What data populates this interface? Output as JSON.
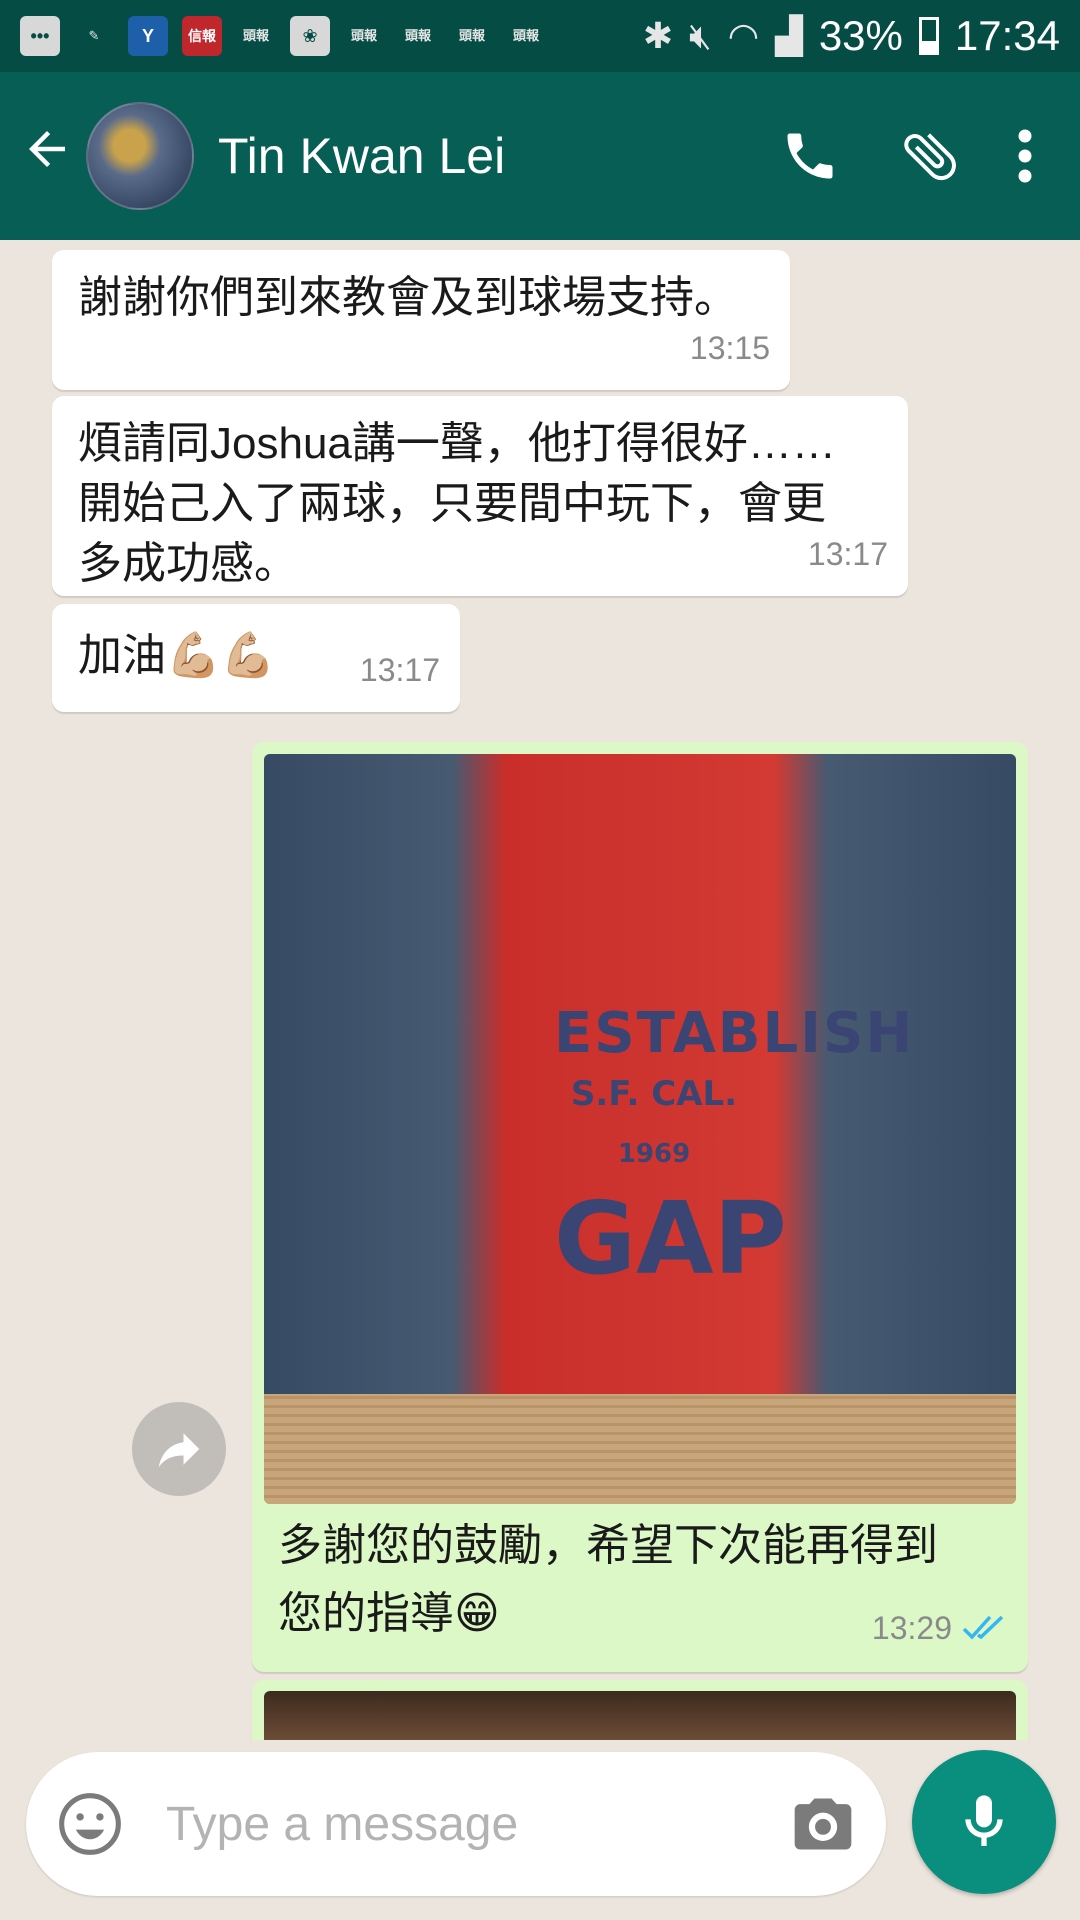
{
  "status_bar": {
    "battery": "33%",
    "time": "17:34",
    "notification_icons": [
      "message-icon",
      "cleaner-icon",
      "yahoo-icon",
      "news-icon",
      "news-icon",
      "app-icon",
      "news-icon",
      "news-icon",
      "news-icon",
      "news-icon"
    ],
    "notif_labels": {
      "news_mobile": "信報",
      "news_small": "頭報"
    }
  },
  "app_bar": {
    "contact_name": "Tin Kwan Lei",
    "icons": [
      "back-arrow-icon",
      "phone-icon",
      "paperclip-icon",
      "more-vert-icon"
    ],
    "color": "#075e54"
  },
  "messages": [
    {
      "direction": "in",
      "text": "謝謝你們到來教會及到球場支持。",
      "time": "13:15"
    },
    {
      "direction": "in",
      "text": "煩請同Joshua講一聲，他打得很好……開始己入了兩球，只要間中玩下，會更多成功感。",
      "time": "13:17"
    },
    {
      "direction": "in",
      "text": "加油💪🏼💪🏼",
      "time": "13:17"
    },
    {
      "direction": "out",
      "image": true,
      "image_print": [
        "ESTABLISH",
        "S.F. CAL.",
        "1969",
        "GAP"
      ],
      "caption": "多謝您的鼓勵，希望下次能再得到您的指導😁",
      "time": "13:29",
      "status": "read"
    }
  ],
  "input_bar": {
    "placeholder": "Type a message",
    "value": ""
  },
  "colors": {
    "outgoing_bubble": "#dcf8c6",
    "incoming_bubble": "#ffffff",
    "accent": "#0a8f7e",
    "read_ticks": "#34b7f1"
  }
}
